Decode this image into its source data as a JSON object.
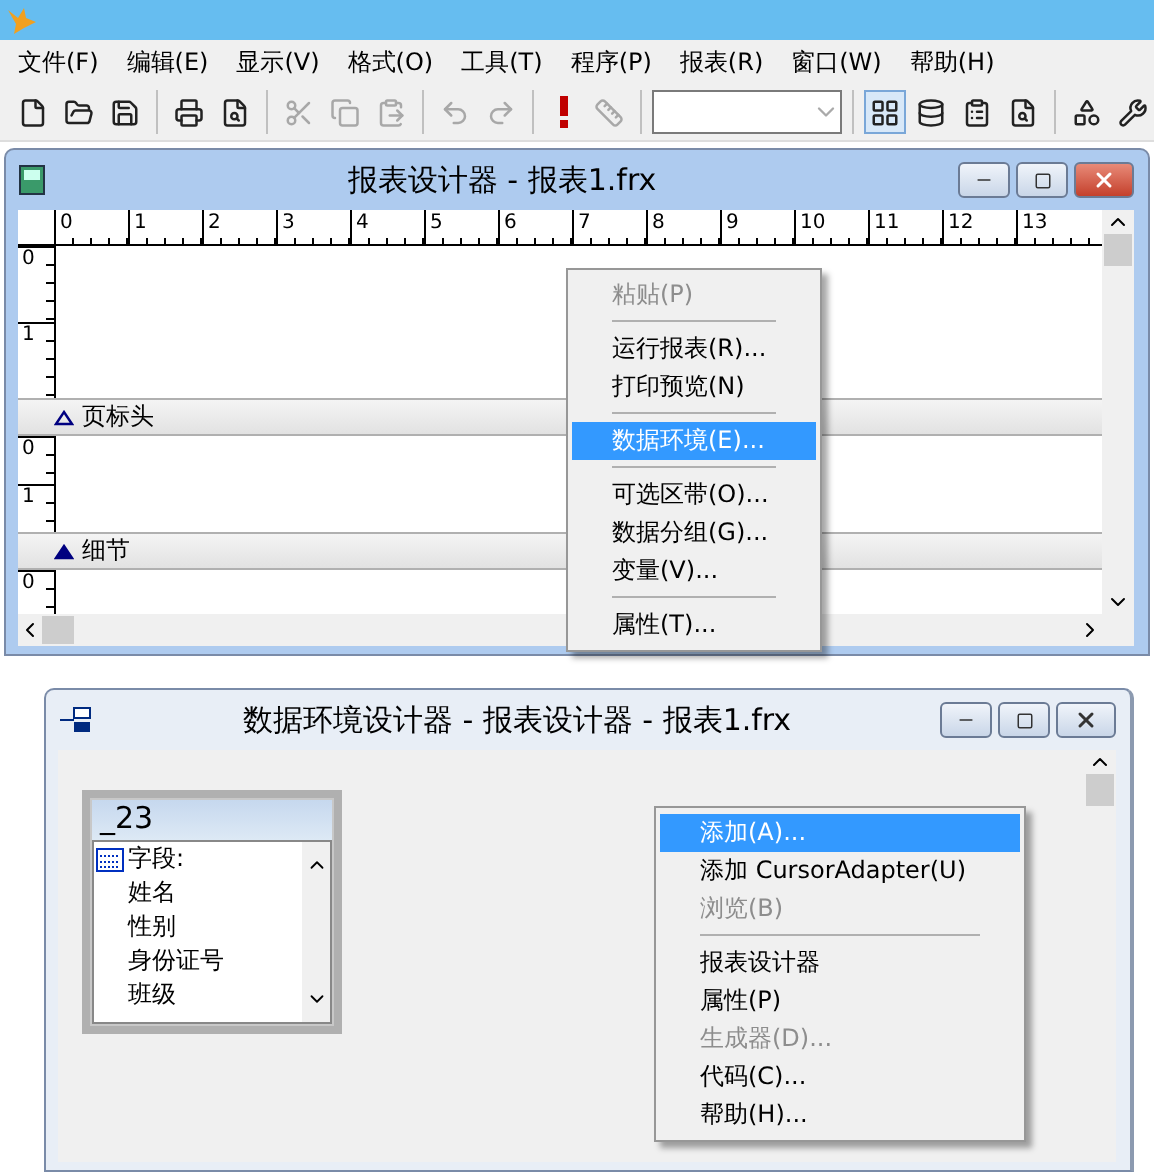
{
  "app": {
    "menu": [
      "文件(F)",
      "编辑(E)",
      "显示(V)",
      "格式(O)",
      "工具(T)",
      "程序(P)",
      "报表(R)",
      "窗口(W)",
      "帮助(H)"
    ],
    "toolbar": [
      {
        "kind": "new",
        "disabled": false,
        "pressed": false
      },
      {
        "kind": "open",
        "disabled": false,
        "pressed": false
      },
      {
        "kind": "save",
        "disabled": false,
        "pressed": false
      },
      {
        "kind": "sep"
      },
      {
        "kind": "print",
        "disabled": false,
        "pressed": false
      },
      {
        "kind": "preview",
        "disabled": false,
        "pressed": false
      },
      {
        "kind": "sep"
      },
      {
        "kind": "cut",
        "disabled": true,
        "pressed": false
      },
      {
        "kind": "copy",
        "disabled": true,
        "pressed": false
      },
      {
        "kind": "paste",
        "disabled": true,
        "pressed": false
      },
      {
        "kind": "sep"
      },
      {
        "kind": "undo",
        "disabled": true,
        "pressed": false
      },
      {
        "kind": "redo",
        "disabled": true,
        "pressed": false
      },
      {
        "kind": "sep"
      },
      {
        "kind": "run",
        "disabled": false,
        "pressed": false
      },
      {
        "kind": "wizard",
        "disabled": true,
        "pressed": false
      },
      {
        "kind": "sep"
      },
      {
        "kind": "combo"
      },
      {
        "kind": "sep"
      },
      {
        "kind": "form",
        "disabled": false,
        "pressed": true
      },
      {
        "kind": "database",
        "disabled": false,
        "pressed": false
      },
      {
        "kind": "properties",
        "disabled": false,
        "pressed": false
      },
      {
        "kind": "code",
        "disabled": false,
        "pressed": false
      },
      {
        "kind": "sep"
      },
      {
        "kind": "classes",
        "disabled": false,
        "pressed": false
      },
      {
        "kind": "tools",
        "disabled": false,
        "pressed": false
      }
    ]
  },
  "report_window": {
    "title": "报表设计器 - 报表1.frx",
    "active": true,
    "ruler": [
      "0",
      "1",
      "2",
      "3",
      "4",
      "5",
      "6",
      "7",
      "8",
      "9",
      "10",
      "11",
      "12",
      "13"
    ],
    "sections": [
      {
        "ruler": [
          "0",
          "1"
        ]
      },
      {
        "ruler": [
          "0",
          "1"
        ],
        "band": {
          "label": "页标头",
          "filled": false
        }
      },
      {
        "ruler": [
          "0"
        ],
        "band": {
          "label": "细节",
          "filled": true
        }
      }
    ],
    "context_menu": [
      {
        "kind": "item",
        "label": "粘贴(P)",
        "disabled": true,
        "selected": false
      },
      {
        "kind": "separator"
      },
      {
        "kind": "item",
        "label": "运行报表(R)...",
        "disabled": false,
        "selected": false
      },
      {
        "kind": "item",
        "label": "打印预览(N)",
        "disabled": false,
        "selected": false
      },
      {
        "kind": "separator"
      },
      {
        "kind": "item",
        "label": "数据环境(E)...",
        "disabled": false,
        "selected": true
      },
      {
        "kind": "separator"
      },
      {
        "kind": "item",
        "label": "可选区带(O)...",
        "disabled": false,
        "selected": false
      },
      {
        "kind": "item",
        "label": "数据分组(G)...",
        "disabled": false,
        "selected": false
      },
      {
        "kind": "item",
        "label": "变量(V)...",
        "disabled": false,
        "selected": false
      },
      {
        "kind": "separator"
      },
      {
        "kind": "item",
        "label": "属性(T)...",
        "disabled": false,
        "selected": false
      }
    ]
  },
  "data_env_window": {
    "title": "数据环境设计器 - 报表设计器 - 报表1.frx",
    "active": false,
    "table": {
      "name": "_23",
      "fields_label": "字段:",
      "fields": [
        "姓名",
        "性别",
        "身份证号",
        "班级"
      ]
    },
    "context_menu": [
      {
        "kind": "item",
        "label": "添加(A)...",
        "disabled": false,
        "selected": true
      },
      {
        "kind": "item",
        "label": "添加 CursorAdapter(U)",
        "disabled": false,
        "selected": false
      },
      {
        "kind": "item",
        "label": "浏览(B)",
        "disabled": true,
        "selected": false
      },
      {
        "kind": "separator"
      },
      {
        "kind": "item",
        "label": "报表设计器",
        "disabled": false,
        "selected": false
      },
      {
        "kind": "item",
        "label": "属性(P)",
        "disabled": false,
        "selected": false
      },
      {
        "kind": "item",
        "label": "生成器(D)...",
        "disabled": true,
        "selected": false
      },
      {
        "kind": "item",
        "label": "代码(C)...",
        "disabled": false,
        "selected": false
      },
      {
        "kind": "item",
        "label": "帮助(H)...",
        "disabled": false,
        "selected": false
      }
    ]
  }
}
